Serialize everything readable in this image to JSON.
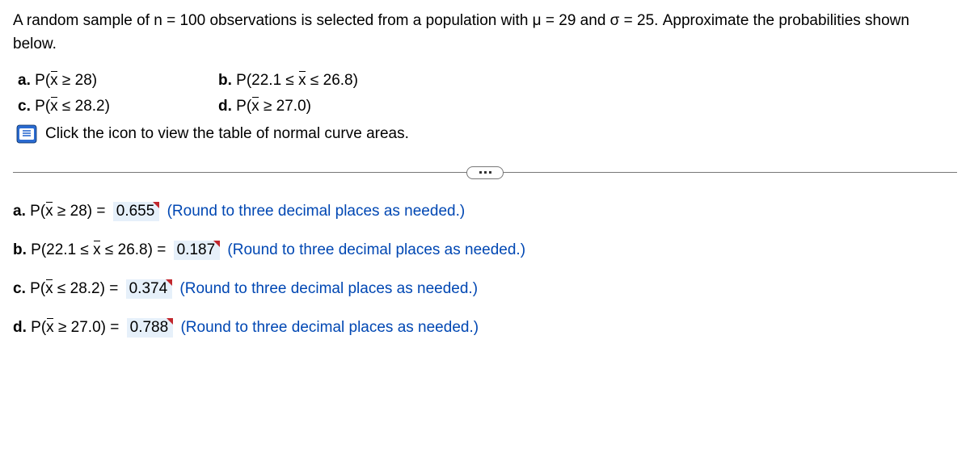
{
  "intro": "A random sample of n = 100 observations is selected from a population with μ = 29 and σ = 25.  Approximate the probabilities shown below.",
  "parts": {
    "a": {
      "prefix": "P(",
      "var": "x",
      "rest": " ≥ 28)"
    },
    "b": {
      "prefix": "P(22.1 ≤ ",
      "var": "x",
      "rest": " ≤ 26.8)"
    },
    "c": {
      "prefix": "P(",
      "var": "x",
      "rest": " ≤ 28.2)"
    },
    "d": {
      "prefix": "P(",
      "var": "x",
      "rest": " ≥ 27.0)"
    }
  },
  "icon_text": "Click the icon to view the table of normal curve areas.",
  "answers": {
    "a": {
      "prefix": "P(",
      "var": "x",
      "rest": " ≥ 28) = ",
      "value": "0.655",
      "hint": "(Round to three decimal places as needed.)"
    },
    "b": {
      "prefix": "P(22.1 ≤ ",
      "var": "x",
      "rest": " ≤ 26.8) = ",
      "value": "0.187",
      "hint": "(Round to three decimal places as needed.)"
    },
    "c": {
      "prefix": "P(",
      "var": "x",
      "rest": " ≤ 28.2) = ",
      "value": "0.374",
      "hint": "(Round to three decimal places as needed.)"
    },
    "d": {
      "prefix": "P(",
      "var": "x",
      "rest": " ≥ 27.0) = ",
      "value": "0.788",
      "hint": "(Round to three decimal places as needed.)"
    }
  },
  "labels": {
    "a": "a.",
    "b": "b.",
    "c": "c.",
    "d": "d."
  }
}
